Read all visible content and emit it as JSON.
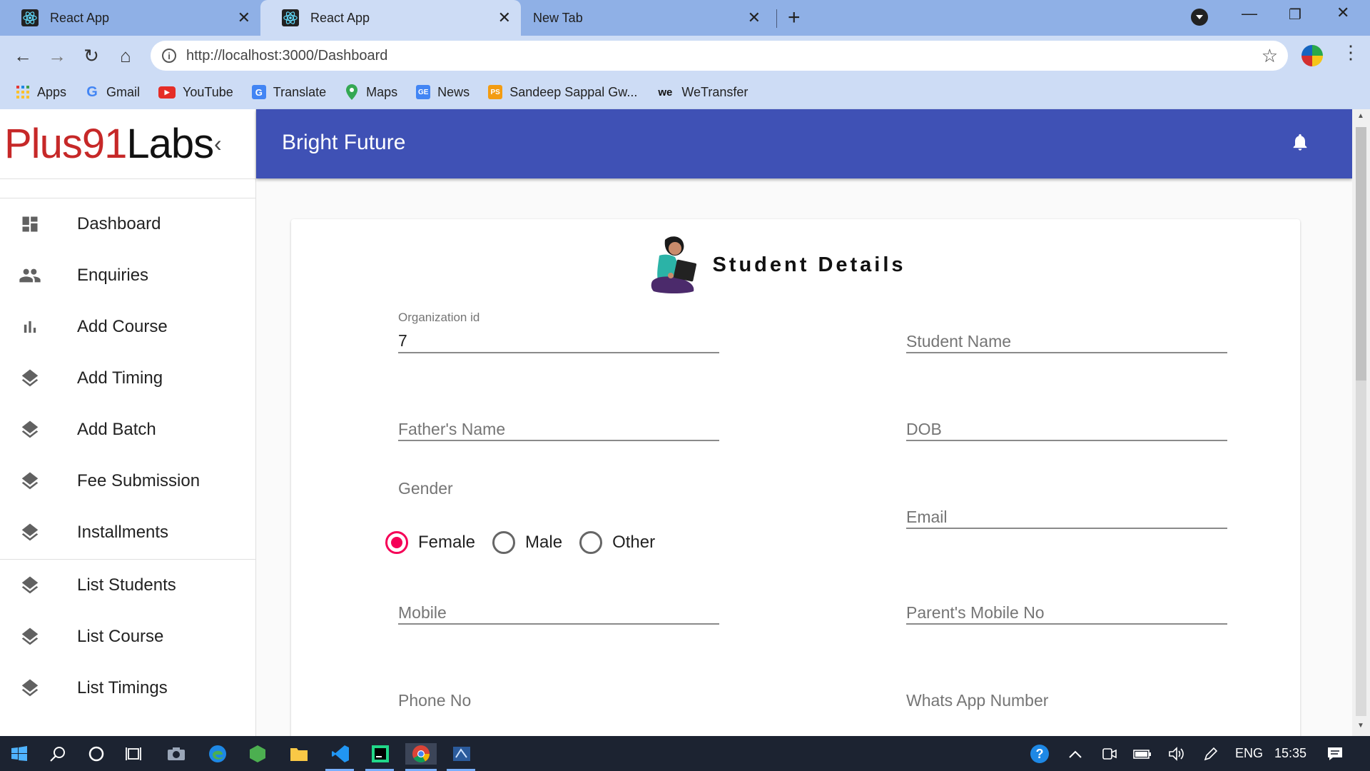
{
  "browser": {
    "tabs": [
      {
        "title": "React App"
      },
      {
        "title": "React App"
      },
      {
        "title": "New Tab"
      }
    ],
    "url": "http://localhost:3000/Dashboard",
    "bookmarks": [
      {
        "label": "Apps"
      },
      {
        "label": "Gmail"
      },
      {
        "label": "YouTube"
      },
      {
        "label": "Translate"
      },
      {
        "label": "Maps"
      },
      {
        "label": "News"
      },
      {
        "label": "Sandeep Sappal Gw..."
      },
      {
        "label": "WeTransfer"
      }
    ]
  },
  "sidebar": {
    "logo_part1": "Plus91",
    "logo_part2": "Labs",
    "items": [
      {
        "label": "Dashboard",
        "icon": "dashboard-icon"
      },
      {
        "label": "Enquiries",
        "icon": "people-icon"
      },
      {
        "label": "Add Course",
        "icon": "bar-chart-icon"
      },
      {
        "label": "Add Timing",
        "icon": "layers-icon"
      },
      {
        "label": "Add Batch",
        "icon": "layers-icon"
      },
      {
        "label": "Fee Submission",
        "icon": "layers-icon"
      },
      {
        "label": "Installments",
        "icon": "layers-icon"
      },
      {
        "label": "List Students",
        "icon": "layers-icon"
      },
      {
        "label": "List Course",
        "icon": "layers-icon"
      },
      {
        "label": "List Timings",
        "icon": "layers-icon"
      }
    ]
  },
  "appbar": {
    "title": "Bright Future"
  },
  "form": {
    "title": "Student Details",
    "organization_id_label": "Organization id",
    "organization_id_value": "7",
    "student_name_label": "Student Name",
    "fathers_name_label": "Father's Name",
    "dob_label": "DOB",
    "gender_label": "Gender",
    "gender_options": [
      "Female",
      "Male",
      "Other"
    ],
    "gender_selected": "Female",
    "email_label": "Email",
    "mobile_label": "Mobile",
    "parents_mobile_label": "Parent's Mobile No",
    "phone_label": "Phone No",
    "whatsapp_label": "Whats App Number"
  },
  "taskbar": {
    "language": "ENG",
    "time": "15:35"
  },
  "colors": {
    "appbar": "#3f51b5",
    "radio_selected": "#f50057",
    "tabstrip": "#8fb0e6",
    "toolbar": "#cddcf5"
  }
}
